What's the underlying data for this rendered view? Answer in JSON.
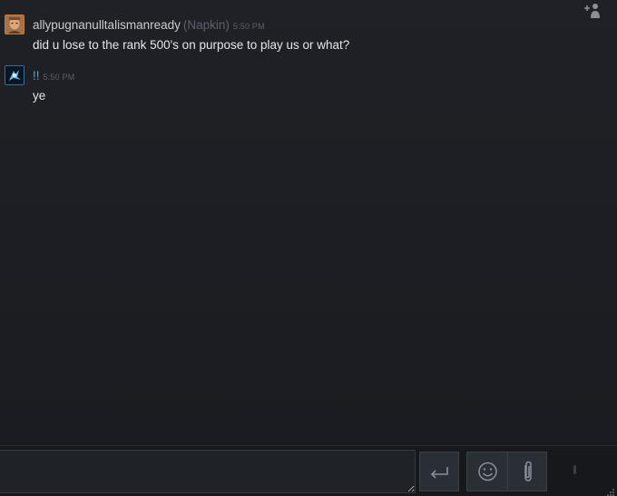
{
  "messages": [
    {
      "sender": "allypugnanulltalismanready",
      "nickname": "(Napkin)",
      "time": "5:50 PM",
      "text": "did u lose to the rank 500's on purpose to play us or what?",
      "avatar": "portrait-avatar"
    },
    {
      "sender": "!!",
      "time": "5:50 PM",
      "text": "ye",
      "avatar": "dark-blue-avatar"
    }
  ],
  "composer": {
    "input_value": "",
    "send_icon": "enter-arrow-icon",
    "emoji_icon": "smiley-icon",
    "attach_icon": "paperclip-icon",
    "voice_icon": "microphone-icon"
  },
  "header": {
    "add_friend_icon": "add-friend-icon"
  },
  "colors": {
    "background": "#1e2025",
    "text": "#e4e6e9",
    "sender_name": "#c9cbcf",
    "sender_name_2": "#5aa3e0",
    "muted": "#5b6069",
    "avatar1_border": "#d07a2f",
    "avatar2_border": "#3b6e8d"
  }
}
